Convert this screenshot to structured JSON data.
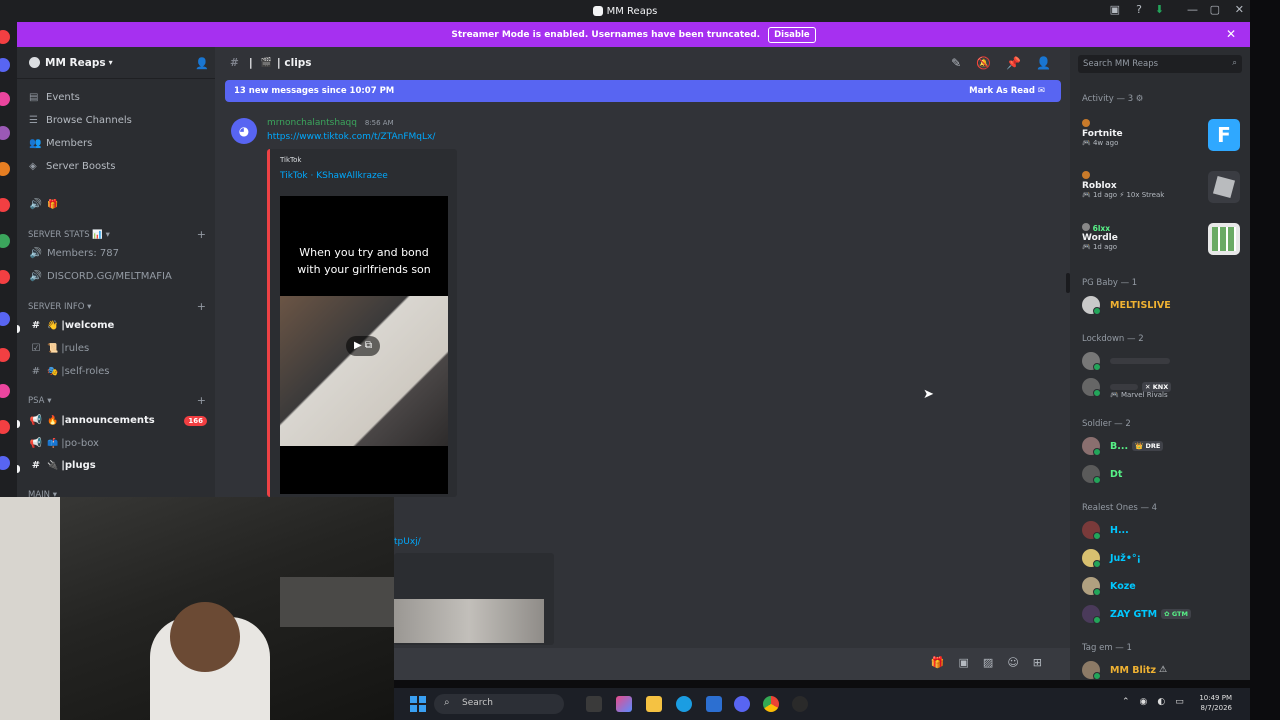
{
  "window": {
    "title": "MM Reaps"
  },
  "banner": {
    "text": "Streamer Mode is enabled. Usernames have been truncated.",
    "disable_label": "Disable"
  },
  "sidebar": {
    "server_name": "MM Reaps",
    "nav": [
      {
        "label": "Events",
        "icon": "calendar-icon"
      },
      {
        "label": "Browse Channels",
        "icon": "browse-icon"
      },
      {
        "label": "Members",
        "icon": "members-icon"
      },
      {
        "label": "Server Boosts",
        "icon": "boost-icon"
      }
    ],
    "categories": {
      "server_stats": "SERVER STATS",
      "server_info": "SERVER INFO",
      "psa": "PSA",
      "main": "MAIN"
    },
    "stats_channels": [
      "Members: 787",
      "DISCORD.GG/MELTMAFIA"
    ],
    "info_channels": [
      {
        "name": "welcome",
        "prefix": "| ",
        "bold": true
      },
      {
        "name": "rules",
        "prefix": "| ",
        "bold": false
      },
      {
        "name": "self-roles",
        "prefix": "| ",
        "bold": false
      }
    ],
    "psa_channels": [
      {
        "name": "announcements",
        "prefix": "| ",
        "bold": true,
        "badge": "166"
      },
      {
        "name": "po-box",
        "prefix": "| ",
        "bold": false
      },
      {
        "name": "plugs",
        "prefix": "| ",
        "bold": true
      }
    ]
  },
  "chat": {
    "channel_name": "| clips",
    "channel_prefix": "|",
    "new_messages": "13 new messages since 10:07 PM",
    "mark_as_read": "Mark As Read",
    "message": {
      "author": "mrnonchalantshaqq",
      "time": "8:56 AM",
      "link": "https://www.tiktok.com/t/ZTAnFMqLx/",
      "embed_provider": "TikTok",
      "embed_title": "TikTok · KShawAllkrazee",
      "video_caption": "When you try and bond with your girlfriends son"
    },
    "second_link_fragment": "tpUxj/"
  },
  "members": {
    "search_placeholder": "Search MM Reaps",
    "activity_header": "Activity — 3",
    "activities": [
      {
        "game": "Fortnite",
        "sub": "4w ago",
        "icon_color": "#2fa8ff"
      },
      {
        "game": "Roblox",
        "sub": "1d ago  ⚡ 10x Streak",
        "icon_color": "#b9bbbe"
      },
      {
        "game": "Wordle",
        "who": "6lxx",
        "sub": "1d ago",
        "icon_color": "#6aaa64"
      }
    ],
    "groups": [
      {
        "name": "PG Baby — 1",
        "members": [
          {
            "name": "MELTISLIVE",
            "color": "#f0b232"
          }
        ]
      },
      {
        "name": "Lockdown — 2",
        "members": [
          {
            "name": "",
            "color": "#3f4147"
          },
          {
            "name": "",
            "color": "#3f4147",
            "tag": "KNX",
            "activity": "Marvel Rivals"
          }
        ]
      },
      {
        "name": "Soldier — 2",
        "members": [
          {
            "name": "B...",
            "color": "#57f287",
            "tag": "DRE"
          },
          {
            "name": "Dt",
            "color": "#57f287"
          }
        ]
      },
      {
        "name": "Realest Ones — 4",
        "members": [
          {
            "name": "H...",
            "color": "#00c8ff"
          },
          {
            "name": "Juž•°¡",
            "color": "#00c8ff"
          },
          {
            "name": "Koze",
            "color": "#00c8ff"
          },
          {
            "name": "ZAY GTM",
            "color": "#00c8ff",
            "tag": "GTM"
          }
        ]
      },
      {
        "name": "Tag em — 1",
        "members": [
          {
            "name": "MM Blitz",
            "color": "#f0b232"
          }
        ]
      }
    ]
  },
  "taskbar": {
    "search_label": "Search",
    "time": "10:49 PM",
    "date": "8/7/2026"
  }
}
